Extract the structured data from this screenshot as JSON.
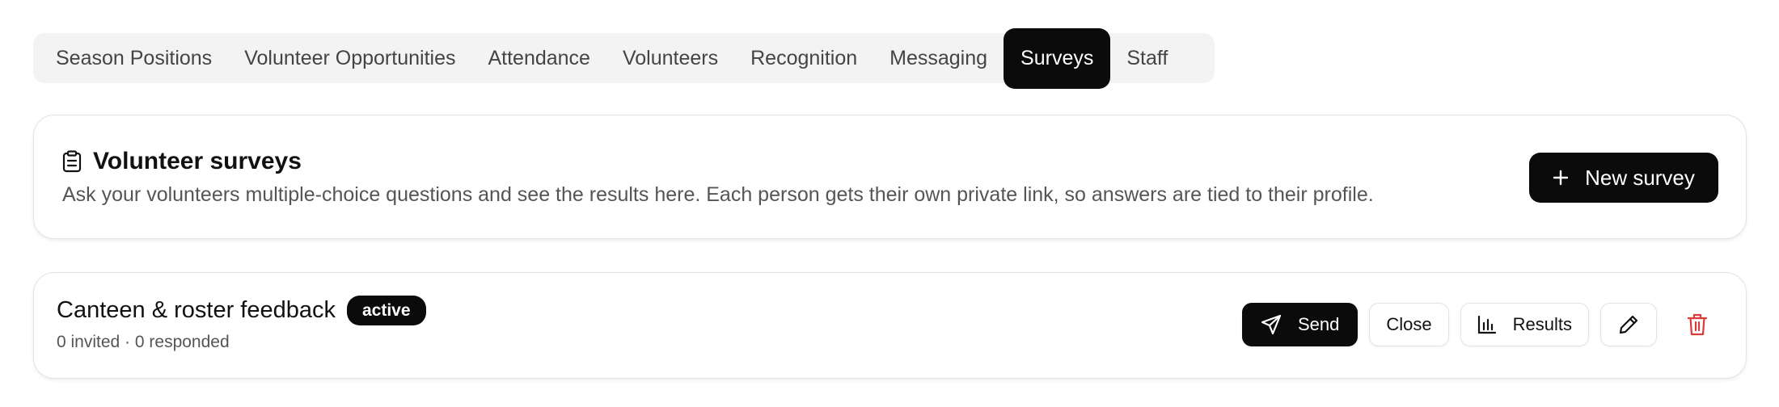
{
  "tabs": [
    {
      "label": "Season Positions",
      "active": false
    },
    {
      "label": "Volunteer Opportunities",
      "active": false
    },
    {
      "label": "Attendance",
      "active": false
    },
    {
      "label": "Volunteers",
      "active": false
    },
    {
      "label": "Recognition",
      "active": false
    },
    {
      "label": "Messaging",
      "active": false
    },
    {
      "label": "Surveys",
      "active": true
    },
    {
      "label": "Staff",
      "active": false
    }
  ],
  "header": {
    "icon": "clipboard-icon",
    "title": "Volunteer surveys",
    "description": "Ask your volunteers multiple-choice questions and see the results here. Each person gets their own private link, so answers are tied to their profile.",
    "new_button_label": "New survey",
    "new_button_icon": "plus-icon"
  },
  "survey": {
    "name": "Canteen & roster feedback",
    "status": "active",
    "meta": "0 invited · 0 responded",
    "send_label": "Send",
    "close_label": "Close",
    "results_label": "Results"
  },
  "colors": {
    "primary": "#0b0b0b",
    "danger": "#d93a3a",
    "tab_bg": "#f3f3f3",
    "border": "#e3e3e3"
  }
}
